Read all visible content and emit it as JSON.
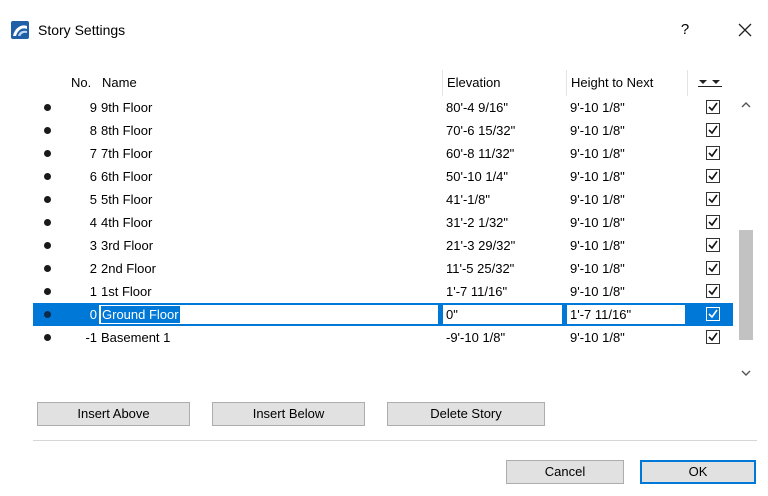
{
  "window": {
    "title": "Story Settings",
    "help_label": "?",
    "app_icon": "archicad-icon"
  },
  "table": {
    "columns": {
      "no": "No.",
      "name": "Name",
      "elevation": "Elevation",
      "height": "Height to Next"
    },
    "rows": [
      {
        "no": "9",
        "name": "9th Floor",
        "elevation": "80'-4 9/16\"",
        "height": "9'-10 1/8\"",
        "show": true
      },
      {
        "no": "8",
        "name": "8th Floor",
        "elevation": "70'-6 15/32\"",
        "height": "9'-10 1/8\"",
        "show": true
      },
      {
        "no": "7",
        "name": "7th Floor",
        "elevation": "60'-8 11/32\"",
        "height": "9'-10 1/8\"",
        "show": true
      },
      {
        "no": "6",
        "name": "6th Floor",
        "elevation": "50'-10 1/4\"",
        "height": "9'-10 1/8\"",
        "show": true
      },
      {
        "no": "5",
        "name": "5th Floor",
        "elevation": "41'-1/8\"",
        "height": "9'-10 1/8\"",
        "show": true
      },
      {
        "no": "4",
        "name": "4th Floor",
        "elevation": "31'-2 1/32\"",
        "height": "9'-10 1/8\"",
        "show": true
      },
      {
        "no": "3",
        "name": "3rd Floor",
        "elevation": "21'-3 29/32\"",
        "height": "9'-10 1/8\"",
        "show": true
      },
      {
        "no": "2",
        "name": "2nd Floor",
        "elevation": "11'-5 25/32\"",
        "height": "9'-10 1/8\"",
        "show": true
      },
      {
        "no": "1",
        "name": "1st Floor",
        "elevation": "1'-7 11/16\"",
        "height": "9'-10 1/8\"",
        "show": true
      },
      {
        "no": "0",
        "name": "Ground Floor",
        "elevation": "0\"",
        "height": "1'-7 11/16\"",
        "show": true,
        "selected": true
      },
      {
        "no": "-1",
        "name": "Basement 1",
        "elevation": "-9'-10 1/8\"",
        "height": "9'-10 1/8\"",
        "show": true
      }
    ]
  },
  "actions": {
    "insert_above": "Insert Above",
    "insert_below": "Insert Below",
    "delete_story": "Delete Story"
  },
  "footer": {
    "cancel": "Cancel",
    "ok": "OK"
  },
  "colors": {
    "selection": "#0078d7",
    "button_face": "#e1e1e1",
    "button_border": "#adadad"
  }
}
